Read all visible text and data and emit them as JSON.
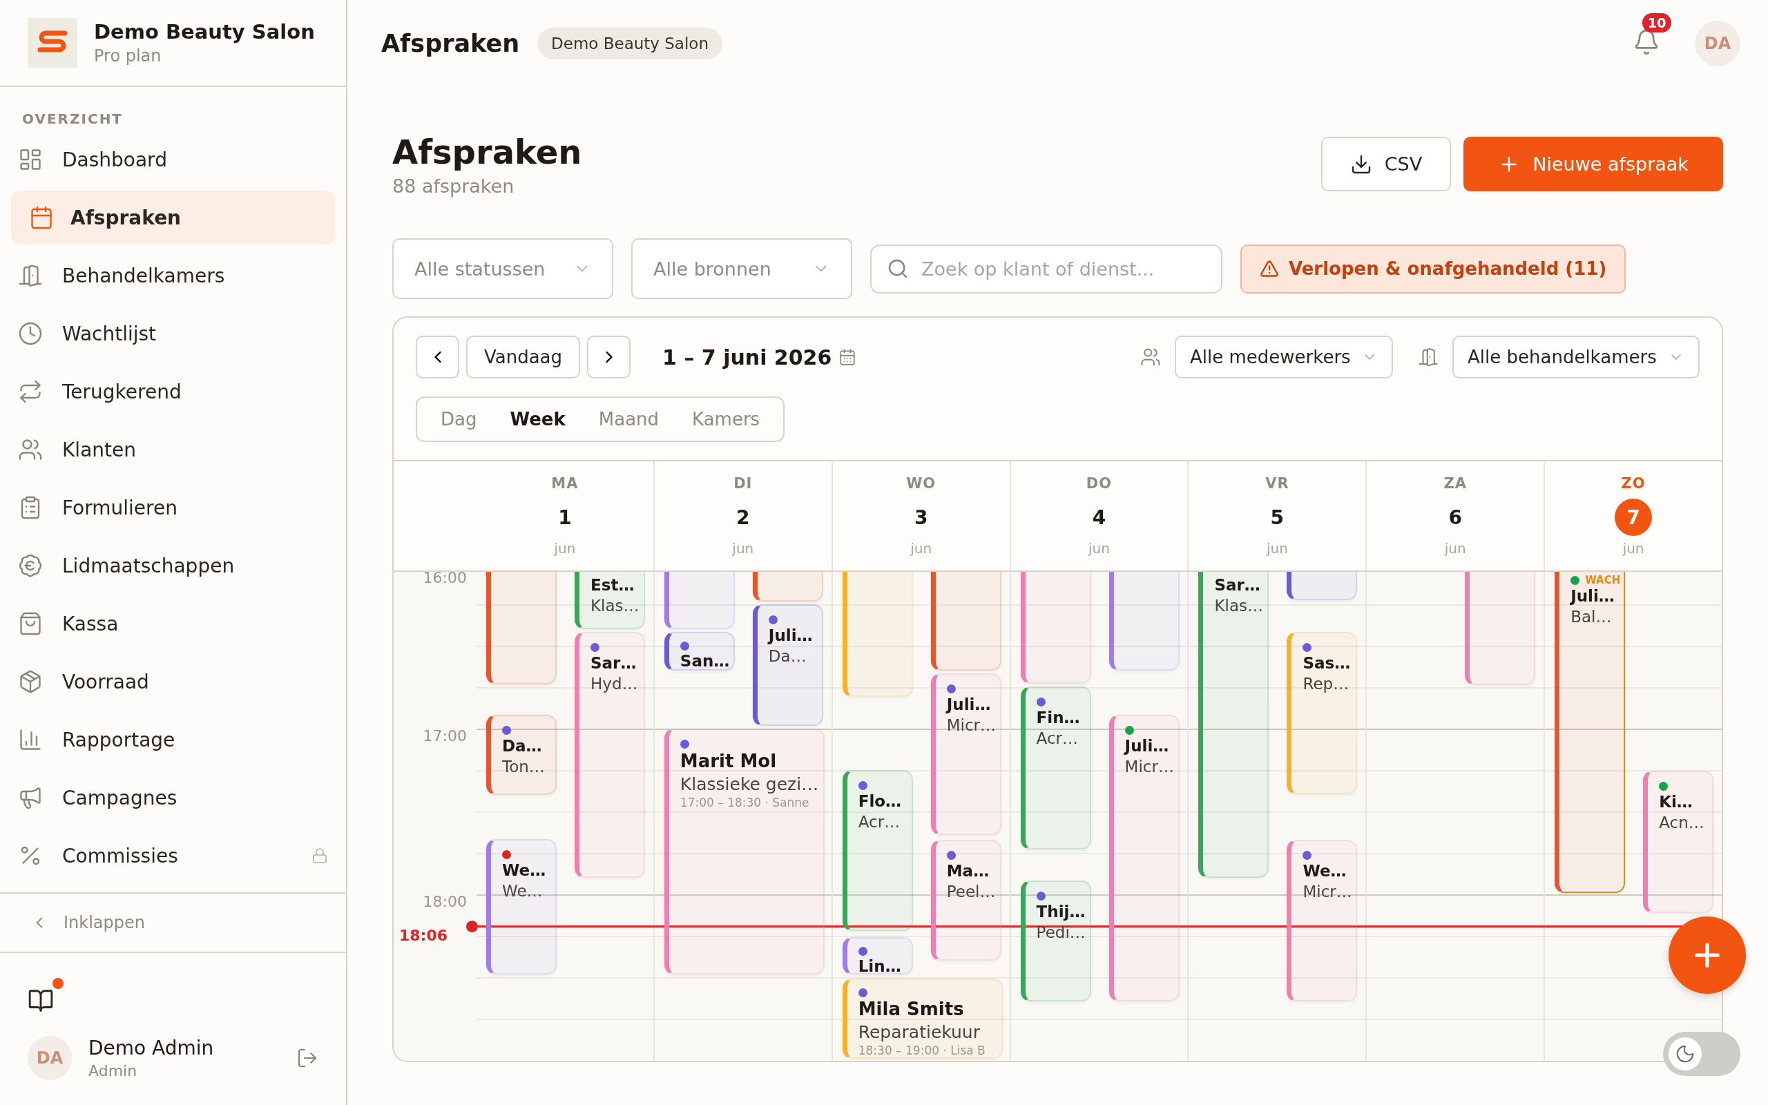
{
  "sidebar": {
    "brand": {
      "name": "Demo Beauty Salon",
      "plan": "Pro plan"
    },
    "section_label": "OVERZICHT",
    "items": [
      {
        "label": "Dashboard",
        "selected": false,
        "locked": false
      },
      {
        "label": "Afspraken",
        "selected": true,
        "locked": false
      },
      {
        "label": "Behandelkamers",
        "selected": false,
        "locked": false
      },
      {
        "label": "Wachtlijst",
        "selected": false,
        "locked": false
      },
      {
        "label": "Terugkerend",
        "selected": false,
        "locked": false
      },
      {
        "label": "Klanten",
        "selected": false,
        "locked": false
      },
      {
        "label": "Formulieren",
        "selected": false,
        "locked": false
      },
      {
        "label": "Lidmaatschappen",
        "selected": false,
        "locked": false
      },
      {
        "label": "Kassa",
        "selected": false,
        "locked": false
      },
      {
        "label": "Voorraad",
        "selected": false,
        "locked": false
      },
      {
        "label": "Rapportage",
        "selected": false,
        "locked": false
      },
      {
        "label": "Campagnes",
        "selected": false,
        "locked": false
      },
      {
        "label": "Commissies",
        "selected": false,
        "locked": true
      }
    ],
    "collapse": "Inklappen",
    "guide_unread": true,
    "user": {
      "initials": "DA",
      "name": "Demo Admin",
      "role": "Admin"
    }
  },
  "header": {
    "title": "Afspraken",
    "badge": "Demo Beauty Salon",
    "notifications": "10",
    "avatar": "DA"
  },
  "page": {
    "title": "Afspraken",
    "count": "88 afspraken",
    "buttons": [
      {
        "label": "CSV",
        "kind": "secondary"
      },
      {
        "label": "Nieuwe afspraak",
        "kind": "primary"
      }
    ]
  },
  "filters": {
    "selects": [
      "Alle statussen",
      "Alle bronnen"
    ],
    "search": {
      "placeholder": "Zoek op klant of dienst..."
    },
    "alert": "Verlopen & onafgehandeld (11)"
  },
  "calendar": {
    "today_button": "Vandaag",
    "range": "1 – 7 juni 2026",
    "staff_filter": "Alle medewerkers",
    "room_filter": "Alle behandelkamers",
    "views": [
      {
        "label": "Dag",
        "selected": false
      },
      {
        "label": "Week",
        "selected": true
      },
      {
        "label": "Maand",
        "selected": false
      },
      {
        "label": "Kamers",
        "selected": false
      }
    ],
    "time_labels": [
      "16:00",
      "17:00",
      "18:00"
    ],
    "now": "18:06",
    "days": [
      {
        "weekday": "MA",
        "day": "1",
        "month": "jun",
        "today": false,
        "events": [
          {
            "color": "#e4572e",
            "outlined": false
          },
          {
            "title": "Est…",
            "subtitle": "Klas…",
            "color": "#3fa45b",
            "outlined": false
          },
          {
            "title": "Sar…",
            "subtitle": "Hyd…",
            "color": "#ec80b0",
            "status_dot": {
              "color": "#6b5bd6"
            },
            "outlined": false
          },
          {
            "title": "Da…",
            "subtitle": "Ton…",
            "color": "#e4572e",
            "status_dot": {
              "color": "#6b5bd6"
            },
            "outlined": false
          },
          {
            "title": "We…",
            "subtitle": "We…",
            "color": "#a07de6",
            "status_dot": {
              "color": "#dc2626"
            },
            "outlined": false
          }
        ]
      },
      {
        "weekday": "DI",
        "day": "2",
        "month": "jun",
        "today": false,
        "events": [
          {
            "color": "#a07de6",
            "outlined": false
          },
          {
            "color": "#e4572e",
            "outlined": false
          },
          {
            "title": "San…",
            "color": "#6b5bd2",
            "status_dot": {
              "color": "#6b5bd6"
            },
            "outlined": false
          },
          {
            "title": "Juli…",
            "subtitle": "Da…",
            "color": "#6b5bd2",
            "status_dot": {
              "color": "#6b5bd6"
            },
            "outlined": false
          },
          {
            "title": "Marit Mol",
            "subtitle": "Klassieke gezi…",
            "detail": "17:00 – 18:30 · Sanne",
            "color": "#ec80b0",
            "status_dot": {
              "color": "#6b5bd6"
            },
            "outlined": false
          }
        ]
      },
      {
        "weekday": "WO",
        "day": "3",
        "month": "jun",
        "today": false,
        "events": [
          {
            "color": "#f5b12a",
            "outlined": false
          },
          {
            "color": "#e4572e",
            "outlined": false
          },
          {
            "title": "Juli…",
            "subtitle": "Micr…",
            "color": "#ec80b0",
            "status_dot": {
              "color": "#6b5bd6"
            },
            "outlined": false
          },
          {
            "title": "Flo…",
            "subtitle": "Acr…",
            "color": "#3fa45b",
            "status_dot": {
              "color": "#6b5bd6"
            },
            "outlined": false
          },
          {
            "title": "Ma…",
            "subtitle": "Peel…",
            "color": "#ec80b0",
            "status_dot": {
              "color": "#6b5bd6"
            },
            "outlined": false
          },
          {
            "title": "Lin…",
            "color": "#a07de6",
            "status_dot": {
              "color": "#6b5bd6"
            },
            "outlined": false
          },
          {
            "title": "Mila Smits",
            "subtitle": "Reparatiekuur",
            "detail": "18:30 – 19:00 · Lisa B",
            "color": "#f5b12a",
            "status_dot": {
              "color": "#6b5bd6"
            },
            "outlined": false
          }
        ]
      },
      {
        "weekday": "DO",
        "day": "4",
        "month": "jun",
        "today": false,
        "events": [
          {
            "color": "#ec80b0",
            "outlined": false
          },
          {
            "color": "#a07de6",
            "outlined": false
          },
          {
            "title": "Fin…",
            "subtitle": "Acr…",
            "color": "#3fa45b",
            "status_dot": {
              "color": "#6b5bd6"
            },
            "outlined": false
          },
          {
            "title": "Juli…",
            "subtitle": "Micr…",
            "color": "#ec80b0",
            "status_dot": {
              "color": "#16a34a"
            },
            "outlined": false
          },
          {
            "title": "Thij…",
            "subtitle": "Pedi…",
            "color": "#3fa45b",
            "status_dot": {
              "color": "#6b5bd6"
            },
            "outlined": false
          }
        ]
      },
      {
        "weekday": "VR",
        "day": "5",
        "month": "jun",
        "today": false,
        "events": [
          {
            "title": "Sar…",
            "subtitle": "Klas…",
            "color": "#3fa45b",
            "outlined": false
          },
          {
            "color": "#6b5bd2",
            "outlined": false
          },
          {
            "title": "Sas…",
            "subtitle": "Rep…",
            "color": "#f5b12a",
            "status_dot": {
              "color": "#6b5bd6"
            },
            "outlined": false
          },
          {
            "title": "We…",
            "subtitle": "Micr…",
            "color": "#ec80b0",
            "status_dot": {
              "color": "#6b5bd6"
            },
            "outlined": false
          }
        ]
      },
      {
        "weekday": "ZA",
        "day": "6",
        "month": "jun",
        "today": false,
        "events": [
          {
            "color": "#ec80b0",
            "outlined": false
          }
        ]
      },
      {
        "weekday": "ZO",
        "day": "7",
        "month": "jun",
        "today": true,
        "events": [
          {
            "status_label": "WACH",
            "title": "Juli…",
            "subtitle": "Bal…",
            "color": "#e4572e",
            "status_dot": {
              "color": "#16a34a"
            },
            "outlined": true
          },
          {
            "title": "Ki…",
            "subtitle": "Acn…",
            "color": "#ec80b0",
            "status_dot": {
              "color": "#16a34a"
            },
            "outlined": false
          }
        ]
      }
    ]
  },
  "dark_mode": {
    "on": false
  }
}
